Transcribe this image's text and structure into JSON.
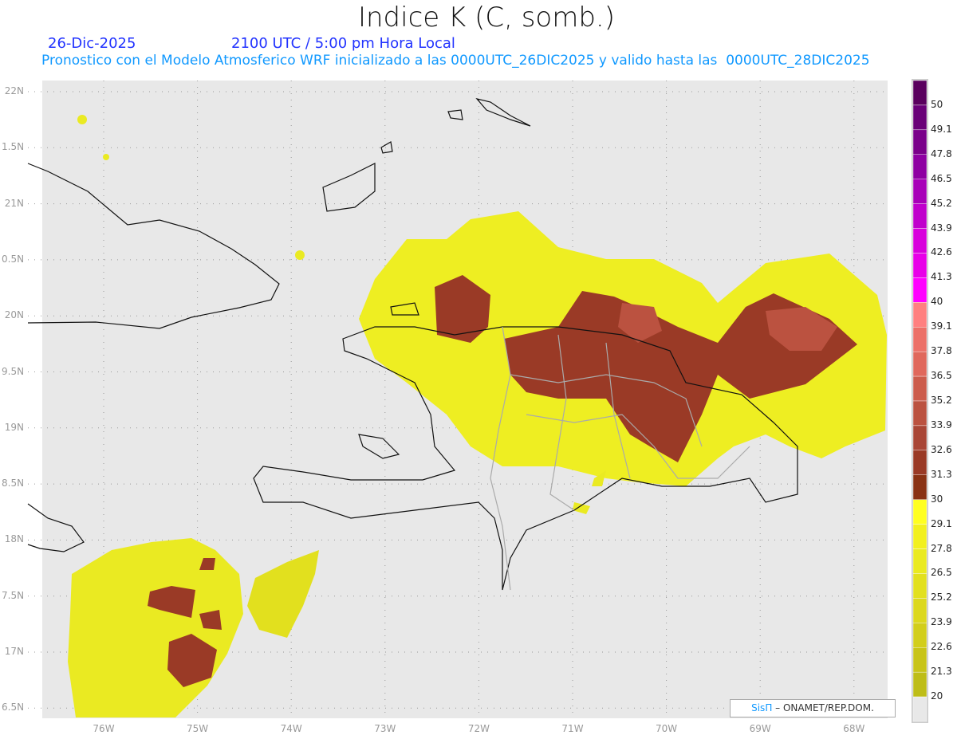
{
  "header": {
    "title": "Indice K (C, somb.)",
    "date": "26-Dic-2025",
    "time": "2100 UTC / 5:00 pm Hora Local",
    "subtitle": "Pronostico con el Modelo Atmosferico WRF inicializado a las 0000UTC_26DIC2025 y valido hasta las  0000UTC_28DIC2025"
  },
  "axes": {
    "lat_labels": [
      "22N",
      "1.5N",
      "21N",
      "0.5N",
      "20N",
      "9.5N",
      "19N",
      "8.5N",
      "18N",
      "7.5N",
      "17N",
      "6.5N"
    ],
    "lon_labels": [
      "76W",
      "75W",
      "74W",
      "73W",
      "72W",
      "71W",
      "70W",
      "69W",
      "68W"
    ]
  },
  "colorbar": {
    "labels": [
      "50",
      "49.1",
      "47.8",
      "46.5",
      "45.2",
      "43.9",
      "42.6",
      "41.3",
      "40",
      "39.1",
      "37.8",
      "36.5",
      "35.2",
      "33.9",
      "32.6",
      "31.3",
      "30",
      "29.1",
      "27.8",
      "26.5",
      "25.2",
      "23.9",
      "22.6",
      "21.3",
      "20"
    ],
    "colors": [
      "#5a005e",
      "#6a0078",
      "#7a008a",
      "#8e00a2",
      "#a800b8",
      "#c000cc",
      "#d800dc",
      "#e800e8",
      "#ff00ff",
      "#ff8080",
      "#ec7068",
      "#e0685c",
      "#cc5c4c",
      "#bb5240",
      "#a94636",
      "#9a3a26",
      "#8a3214",
      "#ffff20",
      "#f2f01e",
      "#eaea20",
      "#e2e01e",
      "#dcd81e",
      "#d2ce1c",
      "#c8c418",
      "#bebd18",
      "#e8e8e8"
    ]
  },
  "credit": {
    "brand": "SisΠ",
    "text": "– ONAMET/REP.DOM."
  }
}
